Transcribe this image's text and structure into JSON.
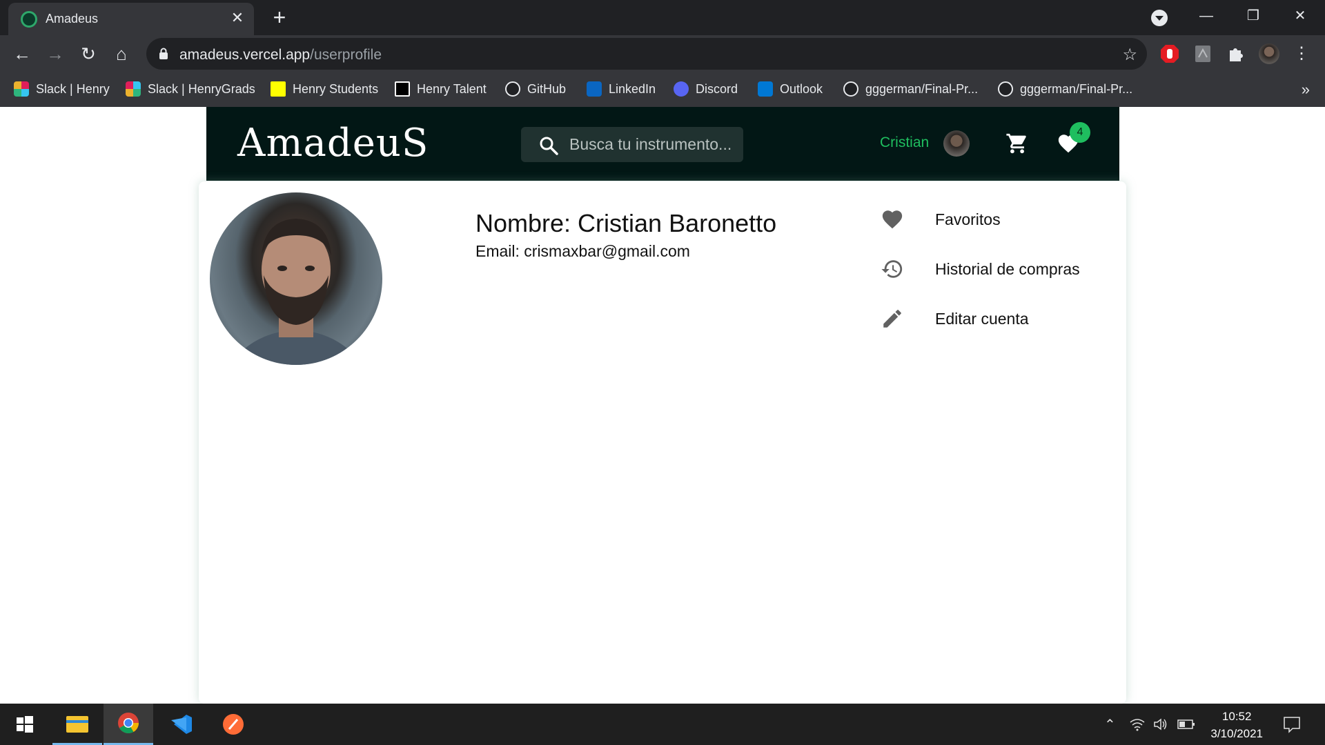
{
  "browser": {
    "tab_title": "Amadeus",
    "url_host": "amadeus.vercel.app",
    "url_path": "/userprofile",
    "bookmarks": [
      {
        "label": "Slack | Henry",
        "icon": "slack-icon",
        "color": "#e01e5a"
      },
      {
        "label": "Slack | HenryGrads",
        "icon": "slack-icon",
        "color": "#36c5f0"
      },
      {
        "label": "Henry Students",
        "icon": "henry-icon",
        "color": "#ffff01"
      },
      {
        "label": "Henry Talent",
        "icon": "henry-talent-icon",
        "color": "#ffffff"
      },
      {
        "label": "GitHub",
        "icon": "github-icon",
        "color": "#e8eaed"
      },
      {
        "label": "LinkedIn",
        "icon": "linkedin-icon",
        "color": "#0a66c2"
      },
      {
        "label": "Discord",
        "icon": "discord-icon",
        "color": "#5865f2"
      },
      {
        "label": "Outlook",
        "icon": "outlook-icon",
        "color": "#0078d4"
      },
      {
        "label": "gggerman/Final-Pr...",
        "icon": "github-icon",
        "color": "#e8eaed"
      },
      {
        "label": "gggerman/Final-Pr...",
        "icon": "github-icon",
        "color": "#e8eaed"
      }
    ]
  },
  "app": {
    "logo": "AmadeuS",
    "search_placeholder": "Busca tu instrumento...",
    "user_name": "Cristian",
    "favorites_count": "4",
    "accent": "#1fbe5f",
    "header_bg": "#021715"
  },
  "profile": {
    "name_line": "Nombre: Cristian Baronetto",
    "email_line": "Email: crismaxbar@gmail.com",
    "menu": [
      {
        "label": "Favoritos",
        "icon": "heart-icon"
      },
      {
        "label": "Historial de compras",
        "icon": "history-icon"
      },
      {
        "label": "Editar cuenta",
        "icon": "edit-pencil-icon"
      }
    ]
  },
  "taskbar": {
    "time": "10:52",
    "date": "3/10/2021"
  }
}
